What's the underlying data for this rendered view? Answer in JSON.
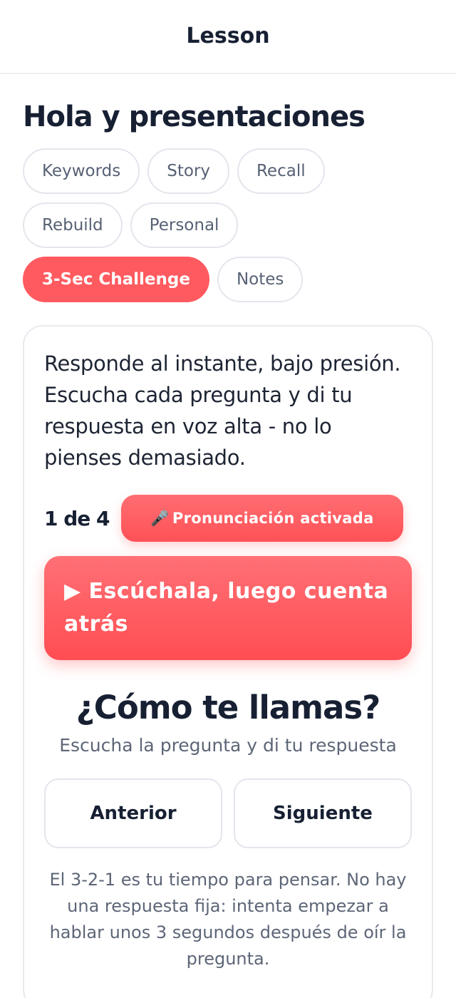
{
  "header": {
    "title": "Lesson"
  },
  "lesson": {
    "title": "Hola y presentaciones"
  },
  "tabs": [
    {
      "label": "Keywords"
    },
    {
      "label": "Story"
    },
    {
      "label": "Recall"
    },
    {
      "label": "Rebuild"
    },
    {
      "label": "Personal"
    },
    {
      "label": "3-Sec Challenge",
      "active": true
    },
    {
      "label": "Notes"
    }
  ],
  "card": {
    "instructions": "Responde al instante, bajo presión. Escucha cada pregunta y di tu respuesta en voz alta - no lo pienses demasiado.",
    "progress": "1 de 4",
    "pronunciation_badge": {
      "icon": "microphone-icon",
      "label": "Pronunciación activada"
    },
    "listen_button": {
      "icon": "play-icon",
      "label": "Escúchala, luego cuenta atrás"
    },
    "question": "¿Cómo te llamas?",
    "question_hint": "Escucha la pregunta y di tu respuesta",
    "prev_label": "Anterior",
    "next_label": "Siguiente",
    "tip": "El 3-2-1 es tu tiempo para pensar. No hay una respuesta fija: intenta empezar a hablar unos 3 segundos después de oír la pregunta."
  },
  "colors": {
    "accent": "#ff5a5f",
    "text_dark": "#172033",
    "text_muted": "#5d6677",
    "border": "#e3e6ec"
  }
}
